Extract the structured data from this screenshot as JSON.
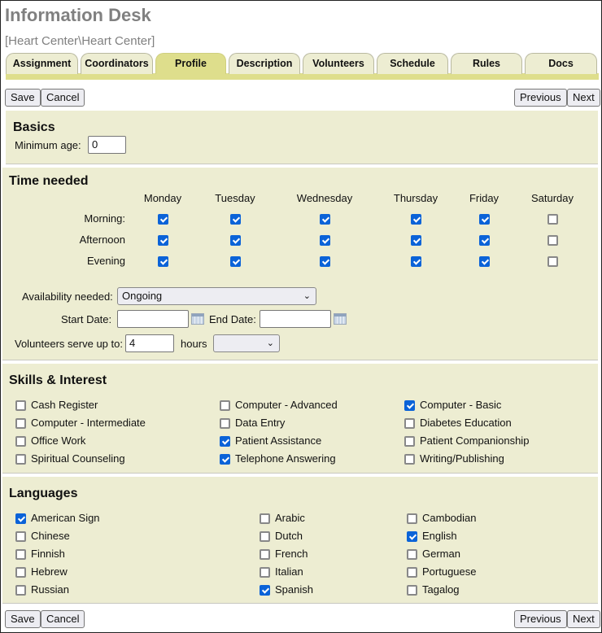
{
  "header": {
    "title": "Information Desk",
    "subtitle": "[Heart Center\\Heart Center]"
  },
  "tabs": [
    {
      "label": "Assignment",
      "active": false
    },
    {
      "label": "Coordinators",
      "active": false
    },
    {
      "label": "Profile",
      "active": true
    },
    {
      "label": "Description",
      "active": false
    },
    {
      "label": "Volunteers",
      "active": false
    },
    {
      "label": "Schedule",
      "active": false
    },
    {
      "label": "Rules",
      "active": false
    },
    {
      "label": "Docs",
      "active": false
    }
  ],
  "toolbar": {
    "save_label": "Save",
    "cancel_label": "Cancel",
    "previous_label": "Previous",
    "next_label": "Next"
  },
  "basics": {
    "heading": "Basics",
    "min_age_label": "Minimum age:",
    "min_age_value": "0"
  },
  "time_needed": {
    "heading": "Time needed",
    "days": [
      "Monday",
      "Tuesday",
      "Wednesday",
      "Thursday",
      "Friday",
      "Saturday"
    ],
    "rows": [
      {
        "label": "Morning:",
        "checked": [
          true,
          true,
          true,
          true,
          true,
          false
        ]
      },
      {
        "label": "Afternoon",
        "checked": [
          true,
          true,
          true,
          true,
          true,
          false
        ]
      },
      {
        "label": "Evening",
        "checked": [
          true,
          true,
          true,
          true,
          true,
          false
        ]
      }
    ],
    "availability_label": "Availability needed:",
    "availability_value": "Ongoing",
    "start_date_label": "Start Date:",
    "start_date_value": "",
    "end_date_label": "End Date:",
    "end_date_value": "",
    "serve_label": "Volunteers serve up to:",
    "serve_value": "4",
    "hours_label": "hours",
    "hours_period_value": ""
  },
  "skills": {
    "heading": "Skills & Interest",
    "columns": [
      [
        {
          "label": "Cash Register",
          "checked": false
        },
        {
          "label": "Computer - Intermediate",
          "checked": false
        },
        {
          "label": "Office Work",
          "checked": false
        },
        {
          "label": "Spiritual Counseling",
          "checked": false
        }
      ],
      [
        {
          "label": "Computer - Advanced",
          "checked": false
        },
        {
          "label": "Data Entry",
          "checked": false
        },
        {
          "label": "Patient Assistance",
          "checked": true
        },
        {
          "label": "Telephone Answering",
          "checked": true
        }
      ],
      [
        {
          "label": "Computer - Basic",
          "checked": true
        },
        {
          "label": "Diabetes Education",
          "checked": false
        },
        {
          "label": "Patient Companionship",
          "checked": false
        },
        {
          "label": "Writing/Publishing",
          "checked": false
        }
      ]
    ]
  },
  "languages": {
    "heading": "Languages",
    "columns": [
      [
        {
          "label": "American Sign",
          "checked": true
        },
        {
          "label": "Chinese",
          "checked": false
        },
        {
          "label": "Finnish",
          "checked": false
        },
        {
          "label": "Hebrew",
          "checked": false
        },
        {
          "label": "Russian",
          "checked": false
        }
      ],
      [
        {
          "label": "Arabic",
          "checked": false
        },
        {
          "label": "Dutch",
          "checked": false
        },
        {
          "label": "French",
          "checked": false
        },
        {
          "label": "Italian",
          "checked": false
        },
        {
          "label": "Spanish",
          "checked": true
        }
      ],
      [
        {
          "label": "Cambodian",
          "checked": false
        },
        {
          "label": "English",
          "checked": true
        },
        {
          "label": "German",
          "checked": false
        },
        {
          "label": "Portuguese",
          "checked": false
        },
        {
          "label": "Tagalog",
          "checked": false
        }
      ]
    ]
  },
  "colors": {
    "panel_bg": "#ededd2",
    "active_tab": "#dede8c",
    "checkbox_checked": "#0b63d8",
    "title_gray": "#808080"
  }
}
